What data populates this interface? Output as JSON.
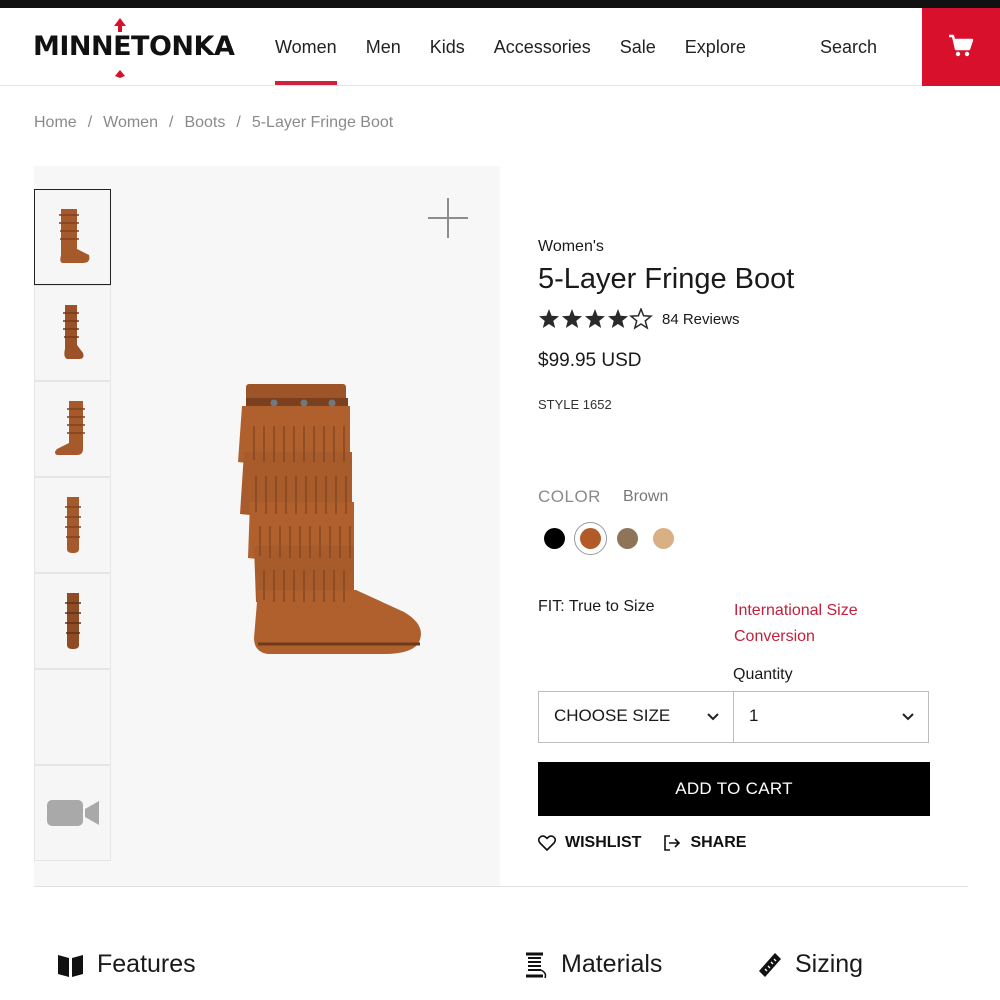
{
  "brand": {
    "name": "MINNETONKA"
  },
  "nav": {
    "items": [
      "Women",
      "Men",
      "Kids",
      "Accessories",
      "Sale",
      "Explore"
    ],
    "search": "Search"
  },
  "breadcrumb": [
    "Home",
    "Women",
    "Boots",
    "5-Layer Fringe Boot"
  ],
  "product": {
    "category": "Women's",
    "title": "5-Layer Fringe Boot",
    "rating": 4.5,
    "reviews": "84 Reviews",
    "price": "$99.95 USD",
    "style": "STYLE 1652",
    "color_label": "COLOR",
    "color_value": "Brown",
    "swatches": [
      "#000000",
      "#b35a2a",
      "#8f7558",
      "#d8b083"
    ],
    "fit": "FIT: True to Size",
    "intl_size": "International Size Conversion",
    "quantity_label": "Quantity",
    "size_select": "CHOOSE SIZE",
    "quantity_value": "1",
    "add_to_cart": "ADD TO CART",
    "wishlist": "WISHLIST",
    "share": "SHARE"
  },
  "tabs": {
    "features": "Features",
    "materials": "Materials",
    "sizing": "Sizing"
  },
  "colors": {
    "accent": "#d8102c",
    "link": "#c3203a",
    "boot": "#a65a2c"
  }
}
